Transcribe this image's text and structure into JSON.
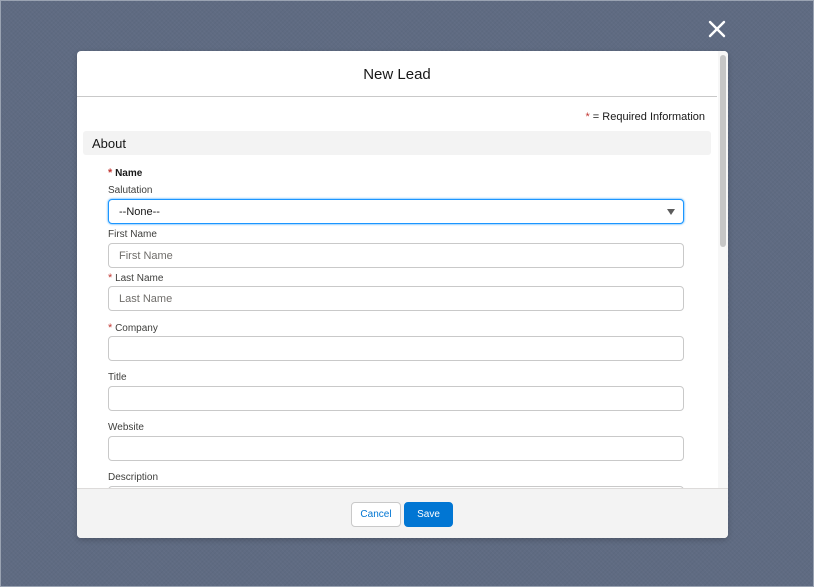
{
  "modal": {
    "title": "New Lead",
    "required_marker": "*",
    "required_info": "= Required Information"
  },
  "section": {
    "title": "About"
  },
  "form": {
    "name_group_label": "Name",
    "salutation": {
      "label": "Salutation",
      "value": "--None--"
    },
    "first_name": {
      "label": "First Name",
      "placeholder": "First Name"
    },
    "last_name": {
      "label": "Last Name",
      "placeholder": "Last Name"
    },
    "company": {
      "label": "Company",
      "value": ""
    },
    "title": {
      "label": "Title",
      "value": ""
    },
    "website": {
      "label": "Website",
      "value": ""
    },
    "description": {
      "label": "Description",
      "value": ""
    }
  },
  "footer": {
    "cancel_label": "Cancel",
    "save_label": "Save"
  },
  "colors": {
    "overlay": "#5f6b82",
    "brand": "#0176d3",
    "required": "#c23934",
    "focus": "#1b96ff"
  },
  "icons": {
    "close": "close-icon",
    "dropdown": "chevron-down-icon"
  }
}
